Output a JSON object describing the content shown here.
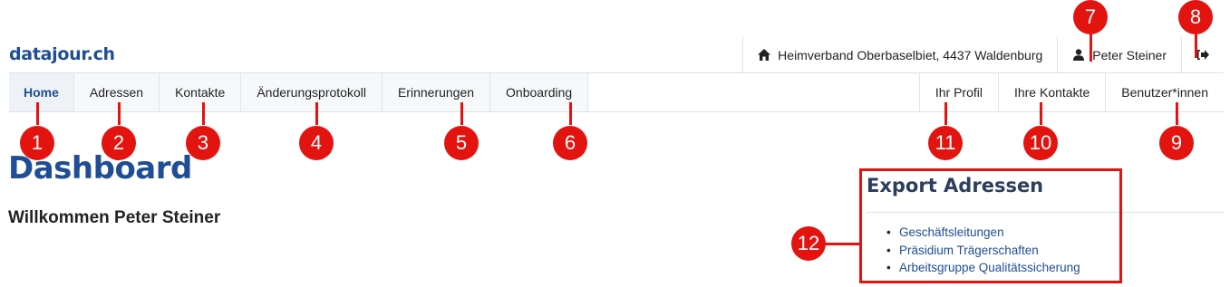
{
  "brand": {
    "logo": "datajour.ch"
  },
  "topbar": {
    "organization": "Heimverband Oberbaselbiet, 4437 Waldenburg",
    "user": "Peter Steiner",
    "icons": {
      "home": "home-icon",
      "user": "user-icon",
      "logout": "logout-icon"
    }
  },
  "nav": {
    "left": [
      "Home",
      "Adressen",
      "Kontakte",
      "Änderungsprotokoll",
      "Erinnerungen",
      "Onboarding"
    ],
    "right": [
      "Ihr Profil",
      "Ihre Kontakte",
      "Benutzer*innen"
    ],
    "active": "Home"
  },
  "main": {
    "title": "Dashboard",
    "welcome": "Willkommen Peter Steiner"
  },
  "export": {
    "title": "Export Adressen",
    "links": [
      "Geschäftsleitungen",
      "Präsidium Trägerschaften",
      "Arbeitsgruppe Qualitätssicherung"
    ]
  },
  "markers": [
    "1",
    "2",
    "3",
    "4",
    "5",
    "6",
    "7",
    "8",
    "9",
    "10",
    "11",
    "12"
  ],
  "colors": {
    "brand": "#1f4e96",
    "marker": "#e3130f"
  }
}
